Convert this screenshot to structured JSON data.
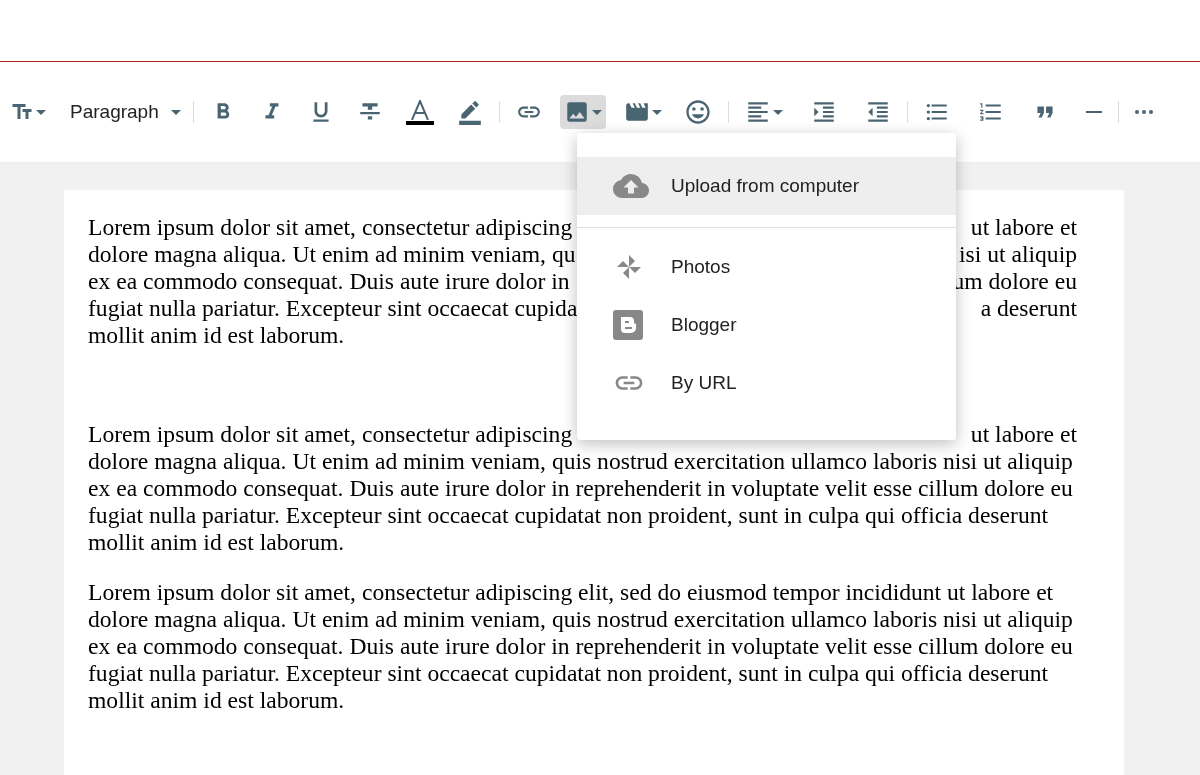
{
  "toolbar": {
    "block_style": "Paragraph",
    "image_button": {
      "expanded": true
    }
  },
  "image_menu": {
    "items": [
      {
        "label": "Upload from computer",
        "selected": true
      },
      {
        "label": "Photos",
        "selected": false
      },
      {
        "label": "Blogger",
        "selected": false
      },
      {
        "label": "By URL",
        "selected": false
      }
    ]
  },
  "document": {
    "paragraphs": [
      {
        "lines": [
          {
            "left": "Lorem ipsum dolor sit amet, consectetur adipiscing",
            "right": "ut labore et"
          },
          {
            "left": "dolore magna aliqua. Ut enim ad minim veniam, qu",
            "right": "isi ut aliquip"
          },
          {
            "left": "ex ea commodo consequat. Duis aute irure dolor in",
            "right": "um dolore eu"
          },
          {
            "left": "fugiat nulla pariatur. Excepteur sint occaecat cupida",
            "right": "a deserunt"
          },
          {
            "left": "mollit anim id est laborum."
          }
        ]
      },
      {
        "lines": [
          {
            "left": "Lorem ipsum dolor sit amet, consectetur adipiscing",
            "right": "ut labore et"
          },
          {
            "left": "dolore magna aliqua. Ut enim ad minim veniam, quis nostrud exercitation ullamco laboris nisi ut aliquip"
          },
          {
            "left": "ex ea commodo consequat. Duis aute irure dolor in reprehenderit in voluptate velit esse cillum dolore eu"
          },
          {
            "left": "fugiat nulla pariatur. Excepteur sint occaecat cupidatat non proident, sunt in culpa qui officia deserunt"
          },
          {
            "left": "mollit anim id est laborum."
          }
        ]
      },
      {
        "lines": [
          {
            "left": "Lorem ipsum dolor sit amet, consectetur adipiscing elit, sed do eiusmod tempor incididunt ut labore et"
          },
          {
            "left": "dolore magna aliqua. Ut enim ad minim veniam, quis nostrud exercitation ullamco laboris nisi ut aliquip"
          },
          {
            "left": "ex ea commodo consequat. Duis aute irure dolor in reprehenderit in voluptate velit esse cillum dolore eu"
          },
          {
            "left": "fugiat nulla pariatur. Excepteur sint occaecat cupidatat non proident, sunt in culpa qui officia deserunt"
          },
          {
            "left": "mollit anim id est laborum."
          }
        ]
      }
    ]
  }
}
